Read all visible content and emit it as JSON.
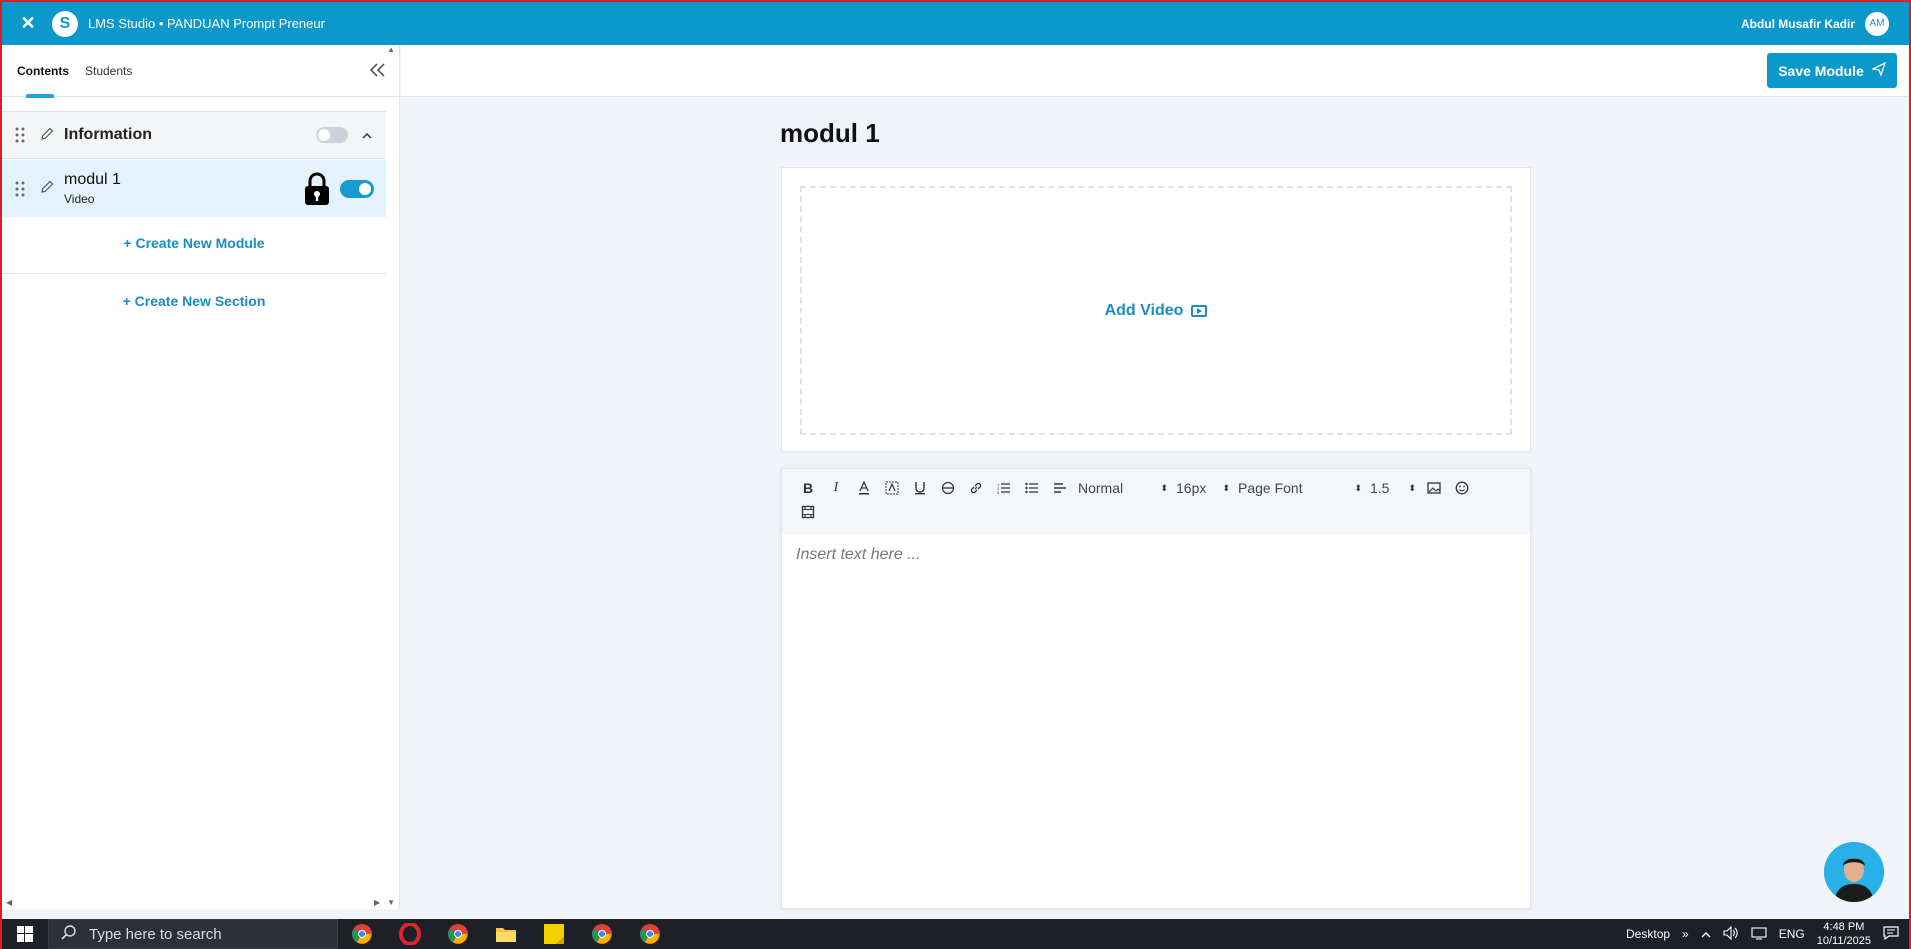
{
  "header": {
    "close_glyph": "✕",
    "logo_glyph": "S",
    "title": "LMS Studio • PANDUAN Prompt Preneur",
    "user_name": "Abdul Musafir Kadir",
    "user_initials": "AM"
  },
  "sidebar": {
    "tabs": [
      {
        "label": "Contents",
        "active": true
      },
      {
        "label": "Students",
        "active": false
      }
    ],
    "section": {
      "title": "Information",
      "published": false
    },
    "module": {
      "title": "modul 1",
      "type": "Video",
      "locked": true,
      "published": true
    },
    "create_module_label": "+ Create New Module",
    "create_section_label": "+ Create New Section"
  },
  "main": {
    "save_button_label": "Save Module",
    "page_title": "modul 1",
    "add_video_label": "Add Video",
    "editor": {
      "paragraph_style": "Normal",
      "font_size": "16px",
      "font_family": "Page Font",
      "line_height": "1.5",
      "placeholder": "Insert text here ..."
    }
  },
  "taskbar": {
    "search_placeholder": "Type here to search",
    "desktop_label": "Desktop",
    "language": "ENG",
    "time": "4:48 PM",
    "date": "10/11/2025"
  },
  "colors": {
    "brand": "#0b99cc",
    "accent_link": "#1a8ec4",
    "selected_row": "#e3f2fb"
  }
}
